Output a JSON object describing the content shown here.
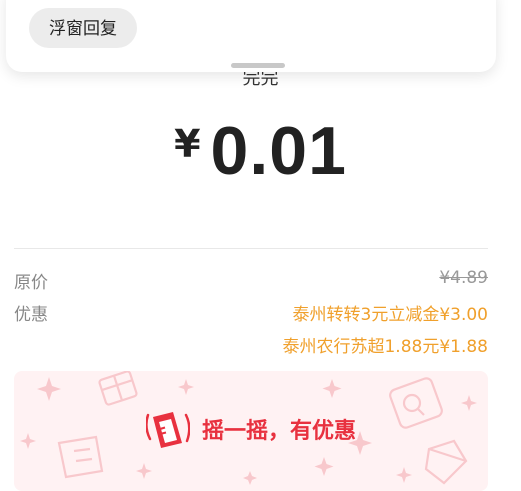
{
  "notification": {
    "reply_button": "浮窗回复"
  },
  "payment": {
    "merchant": "完完",
    "currency_symbol": "¥",
    "amount": "0.01"
  },
  "details": {
    "original_price_label": "原价",
    "original_price_value": "¥4.89",
    "discount_label": "优惠",
    "discounts": [
      "泰州转转3元立减金¥3.00",
      "泰州农行苏超1.88元¥1.88"
    ]
  },
  "promo": {
    "text": "摇一摇，有优惠"
  },
  "colors": {
    "discount": "#f0a02c",
    "promo": "#e8313f",
    "promo_bg": "#fff2f3"
  }
}
